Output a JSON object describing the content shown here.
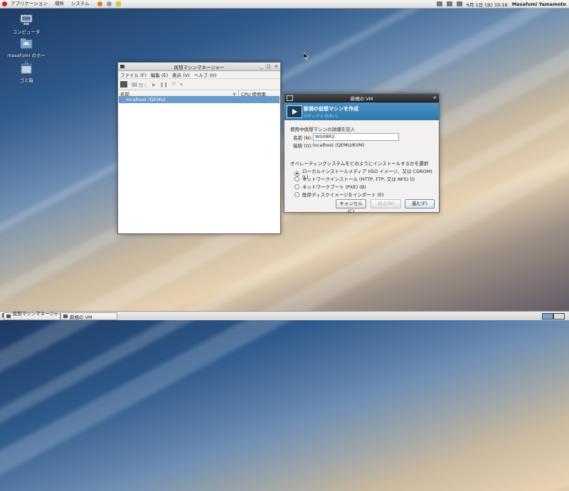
{
  "top_panel": {
    "menus": [
      "アプリケーション",
      "場所",
      "システム"
    ],
    "clock": "6月 1日 (水) 10:16",
    "user": "Masafumi Yamamoto"
  },
  "desktop": {
    "icons": [
      "コンピュータ",
      "masafumi のホーム",
      "ゴミ箱"
    ]
  },
  "vmm_window": {
    "title": "仮想マシンマネージャー",
    "menus": [
      "ファイル (F)",
      "編集 (E)",
      "表示 (V)",
      "ヘルプ (H)"
    ],
    "toolbar_open": "開く",
    "columns": {
      "name": "名前",
      "cpu": "CPU 使用率"
    },
    "rows": [
      "localhost (QEMU)"
    ]
  },
  "new_vm_dialog": {
    "title": "新規の VM",
    "header_title": "新規の仮想マシンを作成",
    "step": "ステップ 1 の(5) 1",
    "section_details": "使用中仮想マシンの詳細を記入",
    "name_label": "名前 (N):",
    "name_value": "WS08R2",
    "connection_label": "接続 (O):",
    "connection_value": "localhost (QEMU/KVM)",
    "section_install": "オペレーティングシステムをどのようにインストールするかを選択",
    "options": [
      "ローカルインストールメディア (ISO イメージ、又は CDROM) (L)",
      "ネットワークインストール (HTTP, FTP, 又は NFS) (I)",
      "ネットワークブート (PXE) (B)",
      "既存ディスクイメージをインポート (E)"
    ],
    "selected_option_index": 0,
    "buttons": {
      "cancel": "キャンセル(C)",
      "back": "戻る(B)",
      "forward": "進む(F)"
    }
  },
  "taskbar": {
    "tasks": [
      "仮想マシンマネージャー",
      "新規の VM"
    ]
  },
  "colors": {
    "selection": "#6b99c9",
    "dialog_banner": "#3a86bb"
  }
}
